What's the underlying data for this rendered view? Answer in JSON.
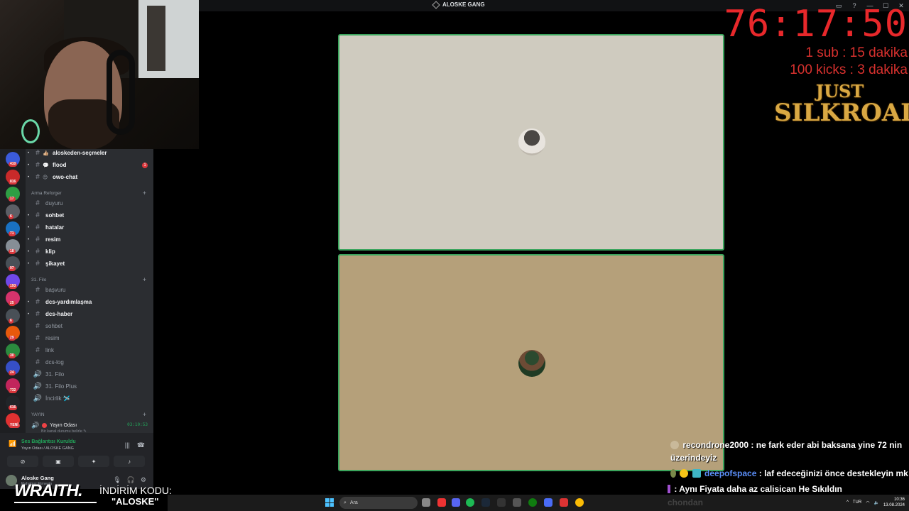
{
  "window": {
    "title": "ALOSKE GANG"
  },
  "server_rail": {
    "badges": [
      "410",
      "816",
      "17",
      "6",
      "71",
      "18",
      "97",
      "193",
      "25",
      "6",
      "29",
      "30",
      "24",
      "732",
      "616",
      "YENİ"
    ]
  },
  "sidebar": {
    "top_channels": [
      {
        "emoji": "👍🏼",
        "name": "aloskeden-seçmeler",
        "unread": true
      },
      {
        "emoji": "💬",
        "name": "flood",
        "unread": true,
        "mention": "1"
      },
      {
        "emoji": "😊",
        "name": "owo-chat",
        "unread": true
      }
    ],
    "category_arma": "Arma Reforger",
    "arma_channels": [
      {
        "name": "duyuru",
        "unread": false
      },
      {
        "name": "sohbet",
        "unread": true
      },
      {
        "name": "hatalar",
        "unread": true
      },
      {
        "name": "resim",
        "unread": true
      },
      {
        "name": "klip",
        "unread": true
      },
      {
        "name": "şikayet",
        "unread": true
      }
    ],
    "category_filo": "31. Filo",
    "filo_channels": [
      {
        "name": "başvuru",
        "unread": false,
        "icon": "#"
      },
      {
        "name": "dcs-yardımlaşma",
        "unread": true,
        "icon": "#"
      },
      {
        "name": "dcs-haber",
        "unread": true,
        "icon": "#"
      },
      {
        "name": "sohbet",
        "unread": false,
        "icon": "#"
      },
      {
        "name": "resim",
        "unread": false,
        "icon": "#"
      },
      {
        "name": "link",
        "unread": false,
        "icon": "#"
      },
      {
        "name": "dcs-log",
        "unread": false,
        "icon": "#"
      },
      {
        "name": "31. Filo",
        "unread": false,
        "icon": "🔊"
      },
      {
        "name": "31. Filo Plus",
        "unread": false,
        "icon": "🔊"
      },
      {
        "name": "İncirlik 🛩️",
        "unread": false,
        "icon": "🔊"
      }
    ],
    "category_yayin": "YAYIN",
    "voice_room": {
      "name": "Yayın Odası",
      "timer": "03:10:53",
      "status": "Bir kanal durumu belirle ✎"
    }
  },
  "voice_panel": {
    "status": "Ses Bağlantısı Kuruldu",
    "room": "Yayın Odası / ALOSKE GANG"
  },
  "user_panel": {
    "name": "Aloske Gang",
    "status": "Rahatsız Etmeyin"
  },
  "overlay": {
    "timer": "76:17:50",
    "rule1": "1 sub : 15 dakika",
    "rule2": "100 kicks : 3 dakika",
    "logo_line1": "JUST",
    "logo_line2": "SILKROAD"
  },
  "chat": [
    {
      "user": "recondrone2000",
      "text": ": ne fark eder abi baksana yine 72 nin"
    },
    {
      "user": "",
      "text": "üzerindeyiz"
    },
    {
      "user": "deepofspace",
      "text": ": laf edeceğinizi önce destekleyin mk"
    },
    {
      "user": "",
      "text": ": Aynı Fiyata daha az calisican He Sıkıldın"
    },
    {
      "user": "",
      "text": "chondan"
    }
  ],
  "sponsor": {
    "brand": "WRAITH.",
    "label": "İNDİRİM KODU:",
    "code": "\"ALOSKE\""
  },
  "taskbar": {
    "search_placeholder": "Ara",
    "language": "TUR",
    "time": "10:36",
    "date": "13.08.2024"
  },
  "colors": {
    "discord_bg": "#2b2d31",
    "speaking_border": "#3ba55d",
    "timer_red": "#e8282b"
  }
}
